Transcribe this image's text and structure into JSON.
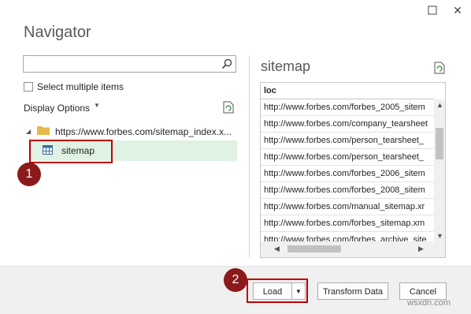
{
  "window": {
    "maximize_icon": "maximize-icon",
    "close_symbol": "✕"
  },
  "navigator": {
    "title": "Navigator",
    "search_placeholder": "",
    "select_multiple_label": "Select multiple items",
    "display_options_label": "Display Options",
    "tree": {
      "root_label": "https://www.forbes.com/sitemap_index.x...",
      "child_label": "sitemap"
    }
  },
  "preview": {
    "title": "sitemap",
    "column": "loc",
    "rows": [
      "http://www.forbes.com/forbes_2005_sitem",
      "http://www.forbes.com/company_tearsheet",
      "http://www.forbes.com/person_tearsheet_",
      "http://www.forbes.com/person_tearsheet_",
      "http://www.forbes.com/forbes_2006_sitem",
      "http://www.forbes.com/forbes_2008_sitem",
      "http://www.forbes.com/manual_sitemap.xr",
      "http://www.forbes.com/forbes_sitemap.xm",
      "http://www.forbes.com/forbes_archive_site"
    ]
  },
  "buttons": {
    "load": "Load",
    "transform": "Transform Data",
    "cancel": "Cancel"
  },
  "callouts": {
    "step1": "1",
    "step2": "2"
  },
  "watermark": "wsxdn.com",
  "colors": {
    "selected_row": "#dff2e3",
    "callout": "#8b1a1a",
    "highlight": "#c00000"
  }
}
